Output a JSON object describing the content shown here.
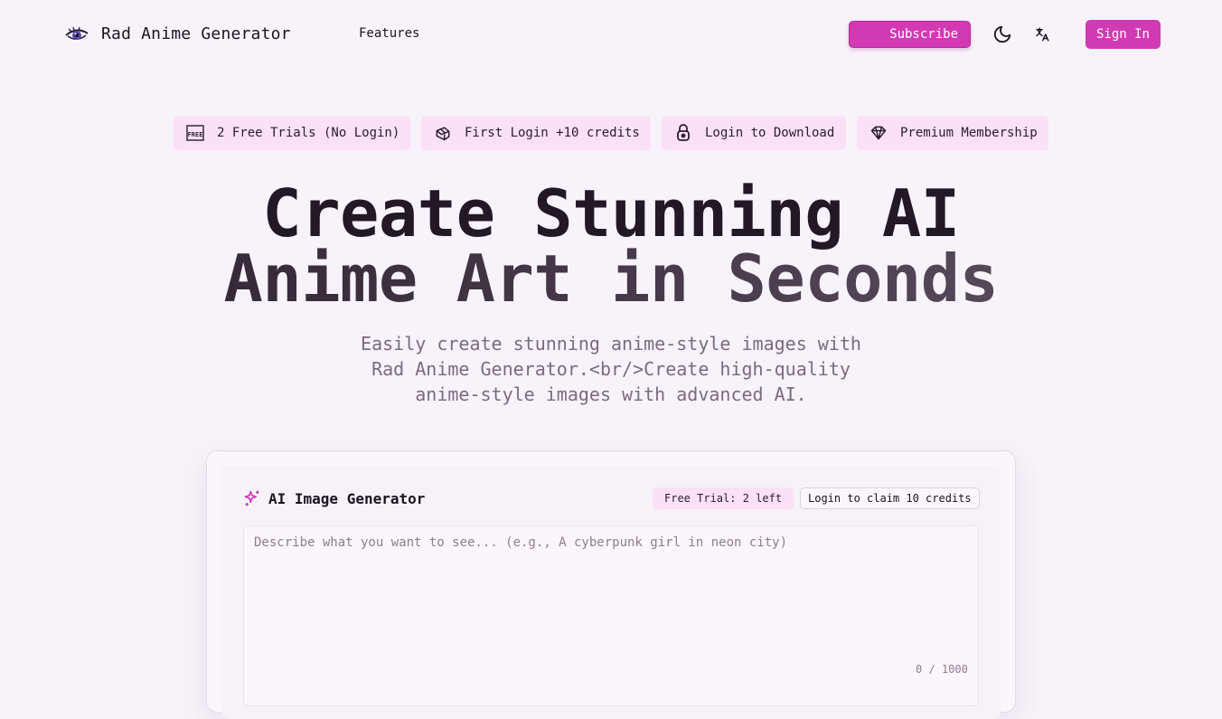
{
  "nav": {
    "brand": "Rad Anime Generator",
    "links": [
      {
        "label": "Features"
      }
    ],
    "subscribe_label": "Subscribe",
    "signin_label": "Sign In",
    "theme_icon": "moon-icon",
    "lang_icon": "translate-icon",
    "accent": "#d23ab4"
  },
  "badges": [
    {
      "label": "2 Free Trials (No Login)",
      "icon": "free-icon"
    },
    {
      "label": "First Login +10 credits",
      "icon": "gift-icon"
    },
    {
      "label": "Login to Download",
      "icon": "lock-icon"
    },
    {
      "label": "Premium Membership",
      "icon": "gem-icon"
    }
  ],
  "hero": {
    "title_line1": "Create Stunning AI",
    "title_line2": "Anime Art in Seconds",
    "subtitle": "Easily create stunning anime-style images with Rad Anime Generator.<br/>Create high-quality anime-style images with advanced AI."
  },
  "generator": {
    "title": "AI Image Generator",
    "trial_label": "Free Trial: 2 left",
    "claim_label": "Login to claim 10 credits",
    "prompt_value": "",
    "prompt_placeholder": "Describe what you want to see... (e.g., A cyberpunk girl in neon city)",
    "counter": "0 / 1000"
  }
}
